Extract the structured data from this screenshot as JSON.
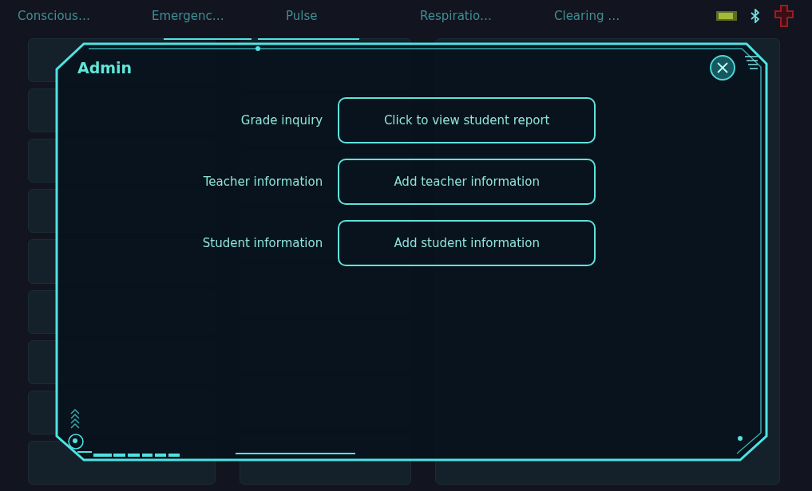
{
  "top_tabs": [
    {
      "label": "Conscious…"
    },
    {
      "label": "Emergenc…"
    },
    {
      "label": "Pulse"
    },
    {
      "label": "Respiratio…"
    },
    {
      "label": "Clearing …"
    }
  ],
  "dialog": {
    "title": "Admin",
    "rows": [
      {
        "label": "Grade inquiry",
        "button": "Click to view student report"
      },
      {
        "label": "Teacher information",
        "button": "Add teacher information"
      },
      {
        "label": "Student information",
        "button": "Add student information"
      }
    ]
  }
}
